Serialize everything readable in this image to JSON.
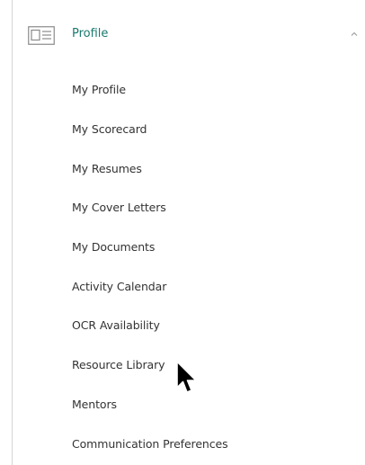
{
  "section": {
    "title": "Profile",
    "icon": "profile-card-icon",
    "expand_icon": "chevron-up-icon",
    "accent_color": "#1a7a6e"
  },
  "menu": {
    "items": [
      {
        "label": "My Profile"
      },
      {
        "label": "My Scorecard"
      },
      {
        "label": "My Resumes"
      },
      {
        "label": "My Cover Letters"
      },
      {
        "label": "My Documents"
      },
      {
        "label": "Activity Calendar"
      },
      {
        "label": "OCR Availability"
      },
      {
        "label": "Resource Library"
      },
      {
        "label": "Mentors"
      },
      {
        "label": "Communication Preferences"
      }
    ]
  },
  "pointer": {
    "icon": "mouse-pointer-icon"
  }
}
